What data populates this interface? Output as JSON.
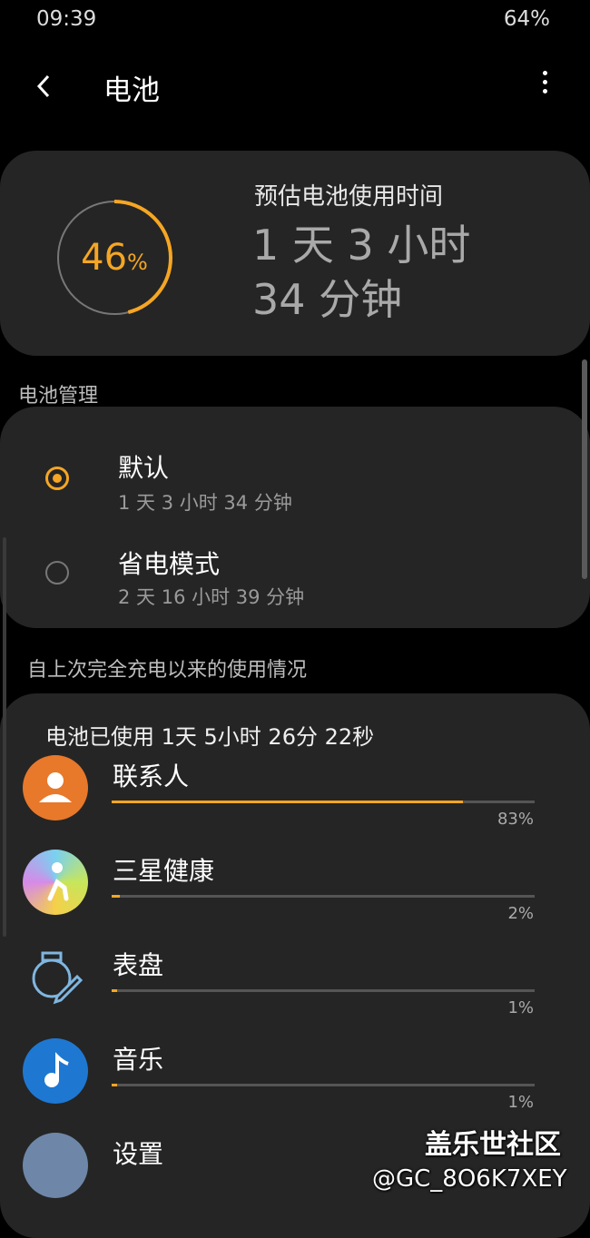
{
  "status_bar": {
    "time": "09:39",
    "battery": "64%"
  },
  "header": {
    "title": "电池",
    "back_icon": "chevron-left-icon",
    "more_icon": "more-vertical-icon"
  },
  "estimate": {
    "percent_number": "46",
    "percent_sign": "%",
    "level": 0.46,
    "label": "预估电池使用时间",
    "line1": "1 天 3 小时",
    "line2": "34 分钟"
  },
  "battery_management": {
    "section_label": "电池管理",
    "options": [
      {
        "title": "默认",
        "subtitle": "1 天 3 小时 34 分钟",
        "selected": true
      },
      {
        "title": "省电模式",
        "subtitle": "2 天 16 小时 39 分钟",
        "selected": false
      }
    ]
  },
  "usage": {
    "section_label": "自上次完全充电以来的使用情况",
    "total_used": "电池已使用 1天 5小时 26分 22秒",
    "apps": [
      {
        "name": "联系人",
        "percent_label": "83%",
        "fraction": 0.83,
        "icon": "contacts-icon"
      },
      {
        "name": "三星健康",
        "percent_label": "2%",
        "fraction": 0.02,
        "icon": "samsung-health-icon"
      },
      {
        "name": "表盘",
        "percent_label": "1%",
        "fraction": 0.01,
        "icon": "watch-face-icon"
      },
      {
        "name": "音乐",
        "percent_label": "1%",
        "fraction": 0.01,
        "icon": "music-icon"
      },
      {
        "name": "设置",
        "percent_label": "",
        "fraction": 0,
        "icon": "settings-icon"
      }
    ]
  },
  "watermark": {
    "line1": "盖乐世社区",
    "line2": "@GC_8O6K7XEY"
  },
  "colors": {
    "accent": "#f5a623",
    "card": "#252525",
    "background": "#000000"
  }
}
